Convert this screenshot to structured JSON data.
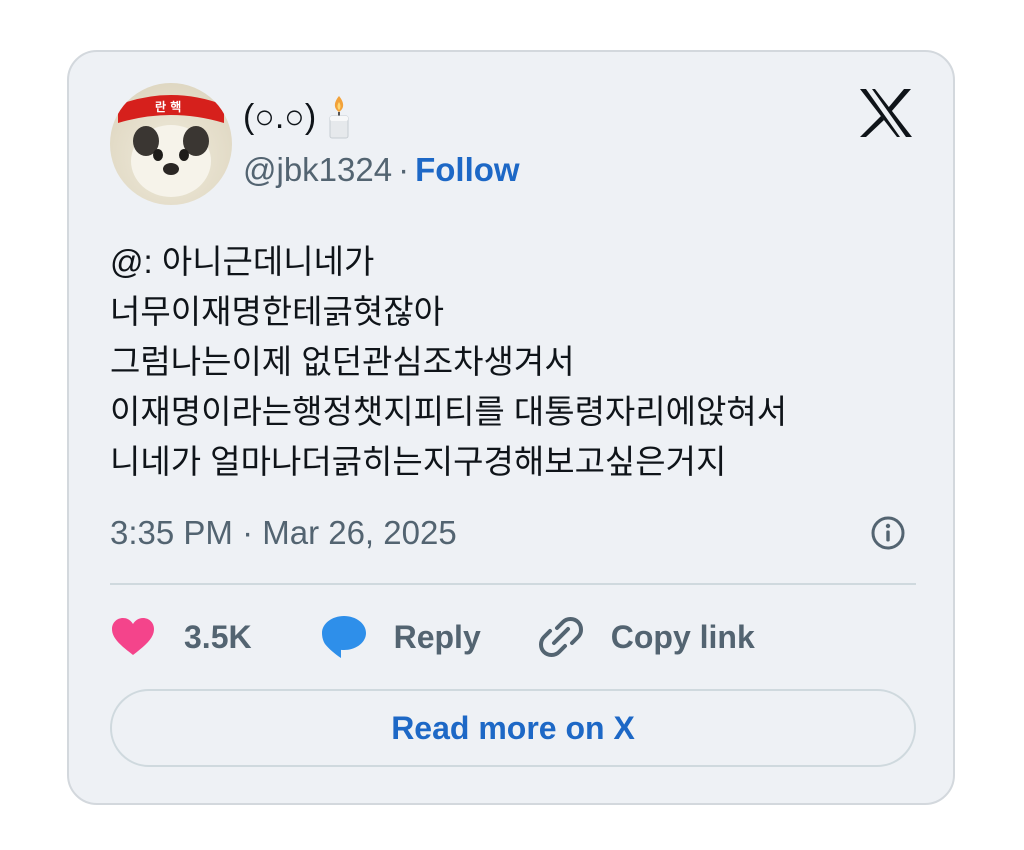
{
  "author": {
    "display_name": "(○.○)",
    "name_emoji": "candle-icon",
    "handle": "@jbk1324",
    "separator": "·",
    "follow_label": "Follow",
    "avatar_headband_text": "란 핵"
  },
  "brand": {
    "logo": "x-logo-icon"
  },
  "tweet": {
    "text": "@: 아니근데니네가\n너무이재명한테긁혓잖아\n그럼나는이제 없던관심조차생겨서\n이재명이라는행정챗지피티를 대통령자리에앉혀서\n니네가 얼마나더긁히는지구경해보고싶은거지",
    "timestamp": "3:35 PM · Mar 26, 2025"
  },
  "actions": {
    "like_count": "3.5K",
    "reply_label": "Reply",
    "copy_label": "Copy link"
  },
  "read_more_label": "Read more on X",
  "colors": {
    "card_bg": "#eef1f5",
    "link_blue": "#1d68c6",
    "like_pink": "#f4448b",
    "reply_blue": "#2e8fea",
    "muted": "#536471"
  }
}
